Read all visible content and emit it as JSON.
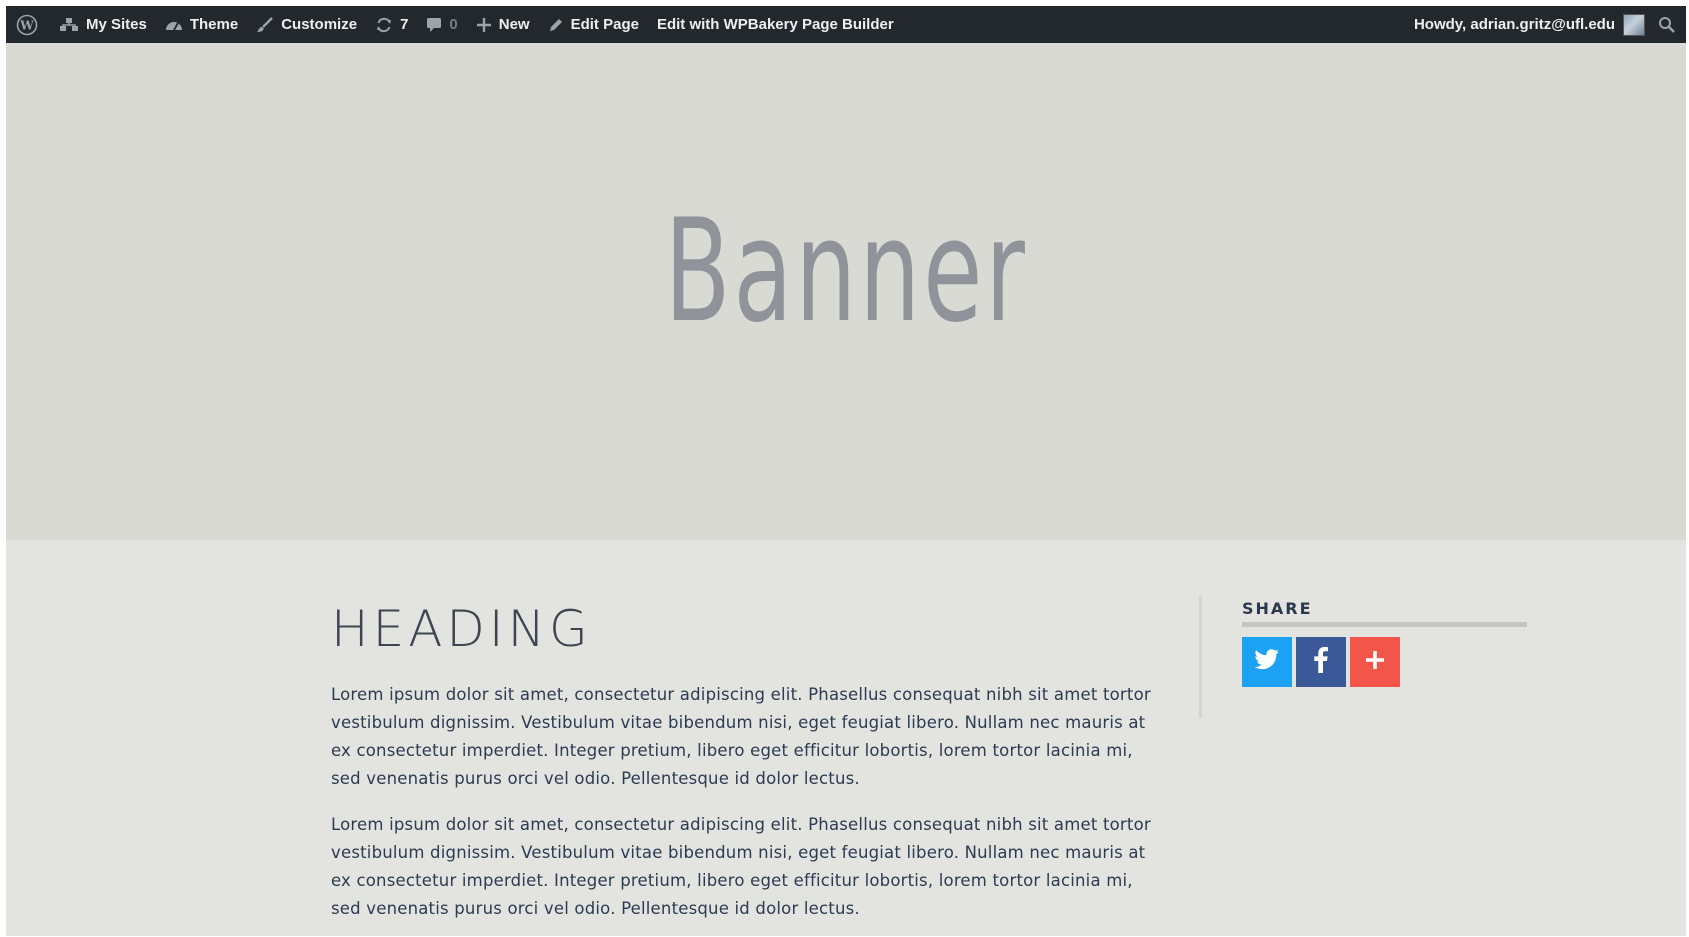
{
  "adminbar": {
    "wp_logo_icon": "wordpress-logo-icon",
    "my_sites": "My Sites",
    "theme": "Theme",
    "customize": "Customize",
    "updates_count": "7",
    "comments_count": "0",
    "new": "New",
    "edit_page": "Edit Page",
    "edit_wpbakery": "Edit with WPBakery Page Builder",
    "howdy": "Howdy, adrian.gritz@ufl.edu"
  },
  "banner": {
    "title": "Banner"
  },
  "main": {
    "heading": "HEADING",
    "paragraphs": [
      "Lorem ipsum dolor sit amet, consectetur adipiscing elit. Phasellus consequat nibh sit amet tortor vestibulum dignissim. Vestibulum vitae bibendum nisi, eget feugiat libero. Nullam nec mauris at ex consectetur imperdiet. Integer pretium, libero eget efficitur lobortis, lorem tortor lacinia mi, sed venenatis purus orci vel odio. Pellentesque id dolor lectus.",
      "Lorem ipsum dolor sit amet, consectetur adipiscing elit. Phasellus consequat nibh sit amet tortor vestibulum dignissim. Vestibulum vitae bibendum nisi, eget feugiat libero. Nullam nec mauris at ex consectetur imperdiet. Integer pretium, libero eget efficitur lobortis, lorem tortor lacinia mi, sed venenatis purus orci vel odio. Pellentesque id dolor lectus."
    ]
  },
  "share": {
    "title": "SHARE",
    "buttons": [
      {
        "name": "twitter",
        "icon": "twitter-icon",
        "color": "#1da1f2"
      },
      {
        "name": "facebook",
        "icon": "facebook-icon",
        "color": "#3b5998"
      },
      {
        "name": "addthis",
        "icon": "plus-icon",
        "color": "#f4554a"
      }
    ]
  },
  "colors": {
    "adminbar_bg": "#23282d",
    "banner_bg": "#d9dad4",
    "content_bg": "#e3e4df",
    "banner_text": "#90949a",
    "body_text": "#2c3a52"
  }
}
